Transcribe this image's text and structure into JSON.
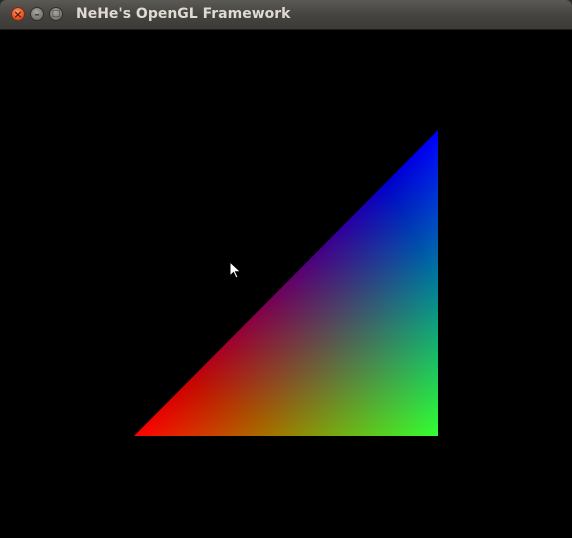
{
  "window": {
    "title": "NeHe's OpenGL Framework",
    "buttons": [
      {
        "name": "close",
        "glyph": "×"
      },
      {
        "name": "minimize",
        "glyph": "–"
      },
      {
        "name": "maximize",
        "glyph": "□"
      }
    ]
  },
  "scene": {
    "background": "#000000",
    "triangle_vertex_colors": {
      "top_right": "#0000ff",
      "bottom_left": "#ff0000",
      "bottom_right": "#00ff00"
    }
  },
  "cursor": {
    "icon": "arrow-cursor-icon"
  }
}
